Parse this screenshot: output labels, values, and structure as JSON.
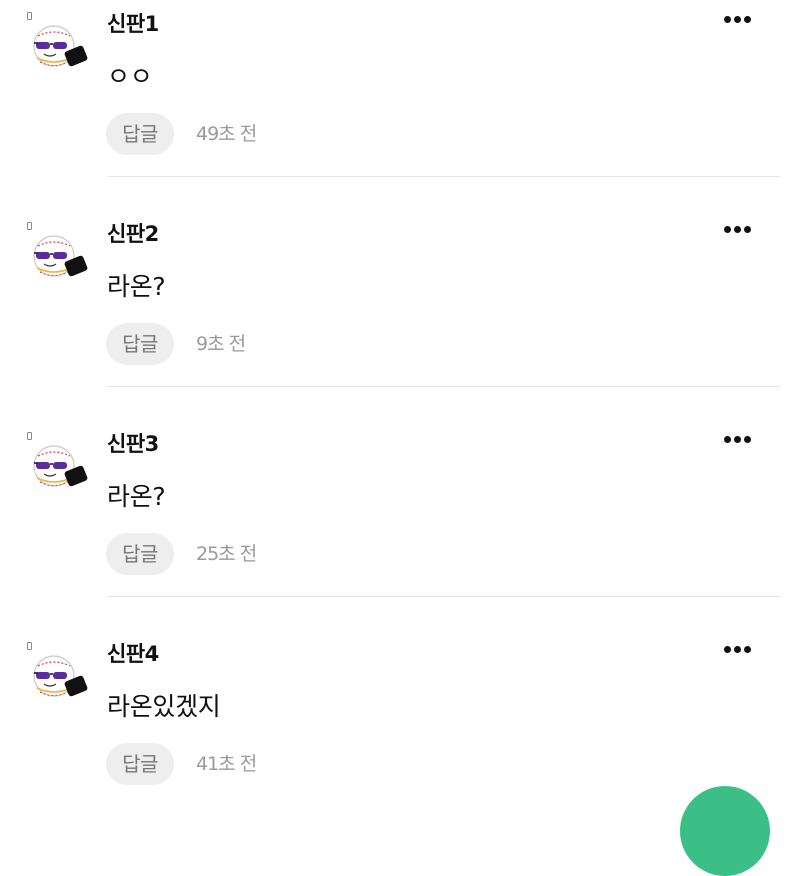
{
  "comments": [
    {
      "author": "신판1",
      "text": "ㅇㅇ",
      "reply_label": "답글",
      "time": "49초 전"
    },
    {
      "author": "신판2",
      "text": "라온?",
      "reply_label": "답글",
      "time": "9초 전"
    },
    {
      "author": "신판3",
      "text": "라온?",
      "reply_label": "답글",
      "time": "25초 전"
    },
    {
      "author": "신판4",
      "text": "라온있겠지",
      "reply_label": "답글",
      "time": "41초 전"
    }
  ],
  "icons": {
    "more": "more-dots-icon",
    "avatar": "baseball-sunglasses-avatar",
    "badge": "member-level-icon"
  },
  "colors": {
    "reply_bg": "#eeeeee",
    "time_text": "#9a9a9a",
    "fab": "#3bbf86"
  }
}
